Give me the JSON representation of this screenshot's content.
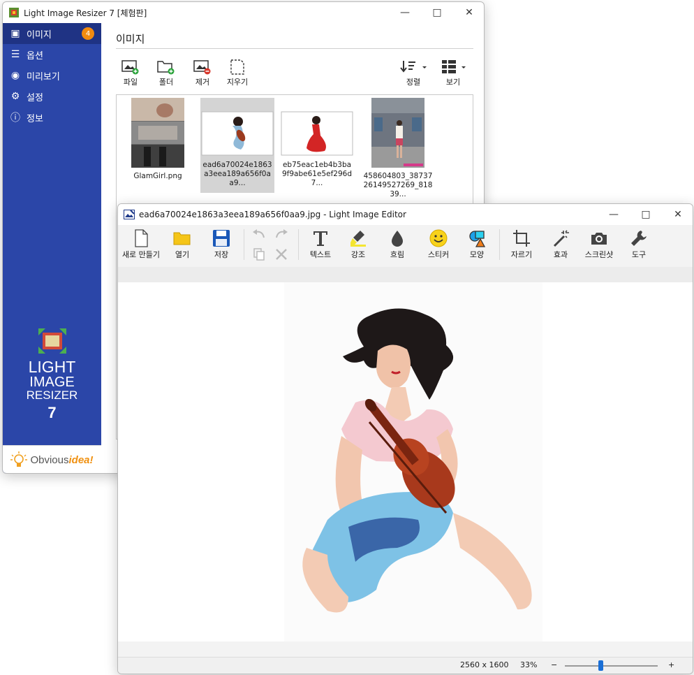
{
  "resizer": {
    "title": "Light Image Resizer 7  [체험판]",
    "sidebar": {
      "items": [
        {
          "label": "이미지",
          "icon": "images-icon",
          "badge": "4"
        },
        {
          "label": "옵션",
          "icon": "sliders-icon"
        },
        {
          "label": "미리보기",
          "icon": "eye-icon"
        },
        {
          "label": "설정",
          "icon": "gear-icon"
        },
        {
          "label": "정보",
          "icon": "info-icon"
        }
      ],
      "brand": {
        "line1": "LIGHT",
        "line2": "IMAGE",
        "line3": "RESIZER",
        "line4": "7"
      },
      "footer": {
        "part1": "Obvious",
        "part2": "idea!"
      }
    },
    "main": {
      "title": "이미지",
      "toolbar": {
        "file": "파일",
        "folder": "폴더",
        "remove": "제거",
        "clear": "지우기",
        "sort": "정렬",
        "view": "보기"
      },
      "thumbnails": [
        {
          "name": "GlamGirl.png"
        },
        {
          "name": "ead6a70024e1863a3eea189a656f0aa9..."
        },
        {
          "name": "eb75eac1eb4b3ba9f9abe61e5ef296d7..."
        },
        {
          "name": "458604803_3873726149527269_81839..."
        }
      ]
    }
  },
  "editor": {
    "title": "ead6a70024e1863a3eea189a656f0aa9.jpg - Light Image Editor",
    "toolbar": {
      "new": "새로 만들기",
      "open": "열기",
      "save": "저장",
      "text": "텍스트",
      "highlight": "강조",
      "blur": "흐림",
      "sticker": "스티커",
      "shape": "모양",
      "crop": "자르기",
      "effects": "효과",
      "screenshot": "스크린샷",
      "tools": "도구"
    },
    "status": {
      "dimensions": "2560 x 1600",
      "zoom": "33%",
      "zoom_out": "−",
      "zoom_in": "+"
    },
    "zoom_slider_fraction": 0.38
  },
  "colors": {
    "sidebar": "#2b46a8",
    "badge": "#f28b10",
    "accent": "#1a6fd6"
  }
}
